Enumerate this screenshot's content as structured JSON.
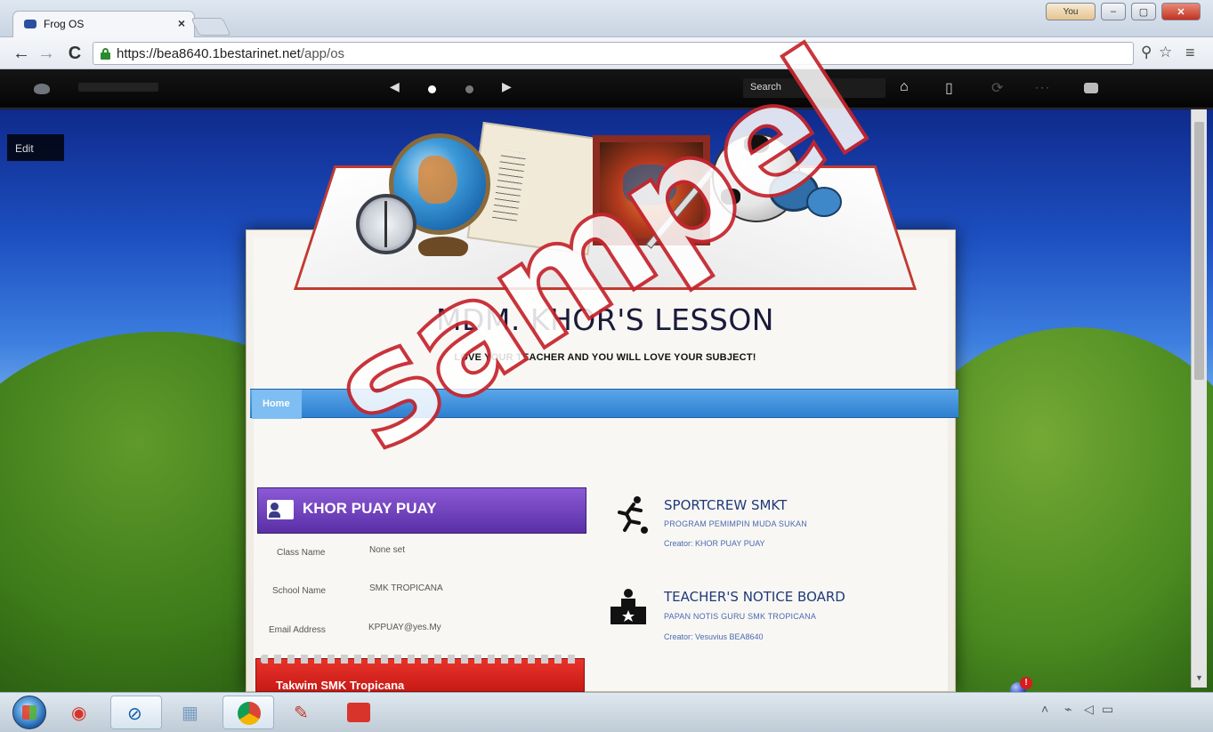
{
  "browser": {
    "tab_title": "Frog OS",
    "tab_close": "×",
    "user_button": "You",
    "url_host": "https://bea8640.1bestarinet.net",
    "url_path": "/app/os",
    "nav_back": "←",
    "nav_forward": "→",
    "nav_reload": "C",
    "search_icon": "magnifier-icon",
    "bookmark_icon": "star-icon",
    "menu_icon": "hamburger-icon"
  },
  "frogbar": {
    "search_label": "Search",
    "carousel_prev": "◀",
    "carousel_next": "▶",
    "home_glyph": "⌂",
    "apps_glyph": "▯",
    "sync_glyph": "⟳",
    "dots_glyph": "···"
  },
  "desktop": {
    "edit_label": "Edit"
  },
  "site": {
    "title": "MDM. KHOR'S LESSON",
    "subtitle": "LOVE YOUR TEACHER AND YOU WILL LOVE YOUR SUBJECT!",
    "nav_home": "Home"
  },
  "profile": {
    "name": "KHOR PUAY PUAY",
    "fields": [
      {
        "label": "Class Name",
        "value": "None set"
      },
      {
        "label": "School Name",
        "value": "SMK TROPICANA"
      },
      {
        "label": "Email Address",
        "value": "KPPUAY@yes.My"
      }
    ]
  },
  "calendar": {
    "title": "Takwim SMK Tropicana"
  },
  "items": [
    {
      "title": "SPORTCREW SMKT",
      "desc": "PROGRAM PEMIMPIN MUDA SUKAN",
      "creator": "Creator: KHOR PUAY PUAY",
      "icon": "runner-icon"
    },
    {
      "title": "TEACHER'S NOTICE BOARD",
      "desc": "PAPAN NOTIS GURU SMK TROPICANA",
      "creator": "Creator: Vesuvius BEA8640",
      "icon": "teacher-desk-icon"
    }
  ],
  "watermark": "sampel",
  "taskbar": {
    "apps": [
      "media-player-icon",
      "hp-icon",
      "documents-icon",
      "chrome-icon",
      "paint-icon",
      "office-icon"
    ],
    "clock_time": "",
    "notification_count": "!"
  },
  "colors": {
    "nav_blue": "#2e7fd1",
    "profile_purple": "#6a3bb8",
    "calendar_red": "#d42520",
    "link_blue": "#4a6ab0"
  }
}
